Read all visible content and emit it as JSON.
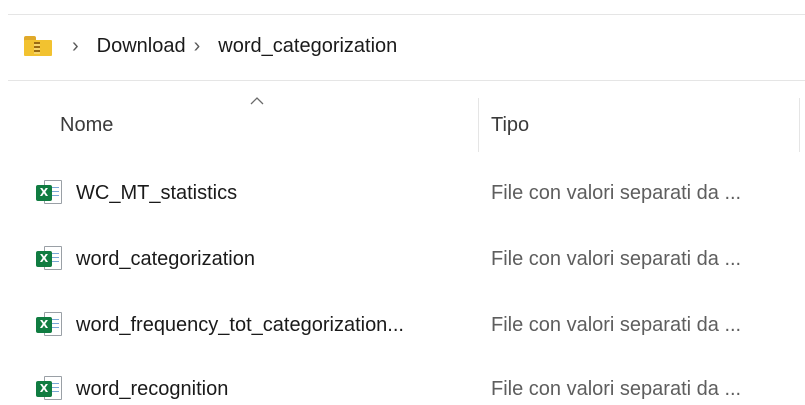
{
  "breadcrumb": {
    "folder_icon": "zip-folder-icon",
    "separator": "›",
    "items": [
      "Download",
      "word_categorization"
    ]
  },
  "columns": {
    "name": "Nome",
    "type": "Tipo",
    "sort_indicator": "chevron-up-icon"
  },
  "files": [
    {
      "name": "WC_MT_statistics",
      "type": "File con valori separati da ...",
      "icon": "excel-csv-icon"
    },
    {
      "name": "word_categorization",
      "type": "File con valori separati da ...",
      "icon": "excel-csv-icon"
    },
    {
      "name": "word_frequency_tot_categorization...",
      "type": "File con valori separati da ...",
      "icon": "excel-csv-icon"
    },
    {
      "name": "word_recognition",
      "type": "File con valori separati da ...",
      "icon": "excel-csv-icon"
    }
  ],
  "colors": {
    "excel_green": "#107c41",
    "folder_yellow": "#f2c230"
  }
}
